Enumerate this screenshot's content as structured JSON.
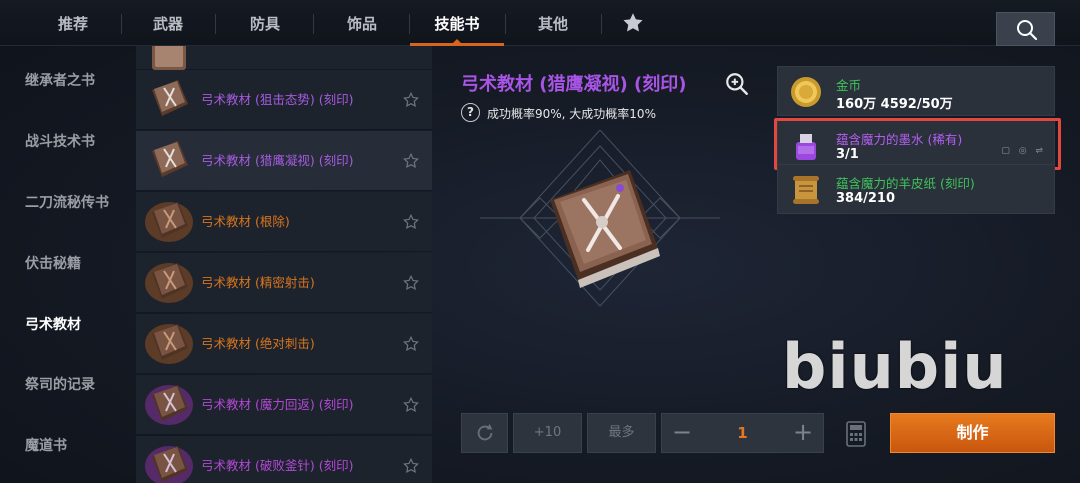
{
  "tabs": [
    {
      "label": "推荐"
    },
    {
      "label": "武器"
    },
    {
      "label": "防具"
    },
    {
      "label": "饰品"
    },
    {
      "label": "技能书"
    },
    {
      "label": "其他"
    }
  ],
  "active_tab": "技能书",
  "categories": [
    {
      "label": "继承者之书"
    },
    {
      "label": "战斗技术书"
    },
    {
      "label": "二刀流秘传书"
    },
    {
      "label": "伏击秘籍"
    },
    {
      "label": "弓术教材"
    },
    {
      "label": "祭司的记录"
    },
    {
      "label": "魔道书"
    }
  ],
  "active_category": "弓术教材",
  "list": [
    {
      "label": "弓术教材 (狙击态势) (刻印)",
      "color": "#a65be0"
    },
    {
      "label": "弓术教材 (猎鹰凝视) (刻印)",
      "color": "#a65be0"
    },
    {
      "label": "弓术教材 (根除)",
      "color": "#d8741d"
    },
    {
      "label": "弓术教材 (精密射击)",
      "color": "#d8741d"
    },
    {
      "label": "弓术教材 (绝对刺击)",
      "color": "#d8741d"
    },
    {
      "label": "弓术教材 (魔力回返) (刻印)",
      "color": "#b348d6"
    },
    {
      "label": "弓术教材 (破败釜针) (刻印)",
      "color": "#b348d6"
    }
  ],
  "detail": {
    "title": "弓术教材 (猎鹰凝视) (刻印)",
    "help_glyph": "?",
    "probability": "成功概率90%, 大成功概率10%"
  },
  "materials": [
    {
      "name": "金币",
      "count": "160万 4592/50万",
      "icon": "gold-coin-icon"
    },
    {
      "name": "蕴含魔力的墨水 (稀有)",
      "count": "3/1",
      "icon": "ink-bottle-icon"
    },
    {
      "name": "蕴含魔力的羊皮纸 (刻印)",
      "count": "384/210",
      "icon": "parchment-icon"
    }
  ],
  "watermark": "biubiu",
  "controls": {
    "plus10": "+10",
    "max": "最多",
    "minus": "−",
    "plus": "+",
    "quantity": "1",
    "craft": "制作"
  },
  "colors": {
    "accent": "#d9641c",
    "craft_button": "#e77a1e",
    "highlight": "#e2483f",
    "rare_purple": "#a855e6",
    "material_green": "#3fc25b"
  }
}
